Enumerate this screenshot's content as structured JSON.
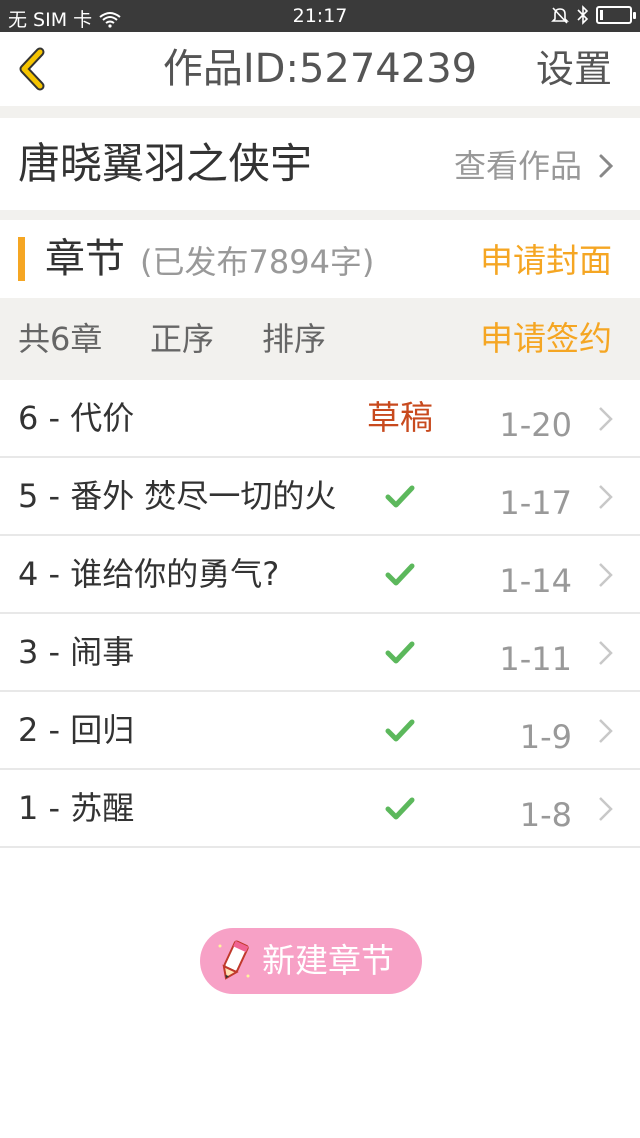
{
  "status_bar": {
    "carrier": "无 SIM 卡",
    "time": "21:17",
    "battery_level": 0.1,
    "icons": [
      "wifi-icon",
      "bell-off-icon",
      "bluetooth-icon",
      "battery-icon"
    ]
  },
  "header": {
    "back_icon": "chevron-left-icon",
    "title": "作品ID:5274239",
    "settings_label": "设置"
  },
  "work": {
    "name": "唐晓翼羽之侠宇",
    "view_label": "查看作品"
  },
  "chapters_section": {
    "label": "章节",
    "published_count": "(已发布7894字)",
    "apply_cover_label": "申请封面"
  },
  "toolbar": {
    "total": "共6章",
    "order_asc": "正序",
    "order_sort": "排序",
    "apply_sign_label": "申请签约"
  },
  "chapters": [
    {
      "title": "6 - 代价",
      "status": "草稿",
      "published": false,
      "date": "1-20"
    },
    {
      "title": "5 - 番外 焚尽一切的火",
      "status": "",
      "published": true,
      "date": "1-17"
    },
    {
      "title": "4 - 谁给你的勇气?",
      "status": "",
      "published": true,
      "date": "1-14"
    },
    {
      "title": "3 - 闹事",
      "status": "",
      "published": true,
      "date": "1-11"
    },
    {
      "title": "2 - 回归",
      "status": "",
      "published": true,
      "date": "1-9"
    },
    {
      "title": "1 - 苏醒",
      "status": "",
      "published": true,
      "date": "1-8"
    }
  ],
  "new_chapter_button": {
    "label": "新建章节",
    "icon": "pencil-icon"
  },
  "colors": {
    "accent_orange": "#f5a623",
    "draft_red": "#c84a1e",
    "check_green": "#5cb85c",
    "new_button_pink": "#f7a1c6",
    "back_yellow": "#f5c400"
  }
}
